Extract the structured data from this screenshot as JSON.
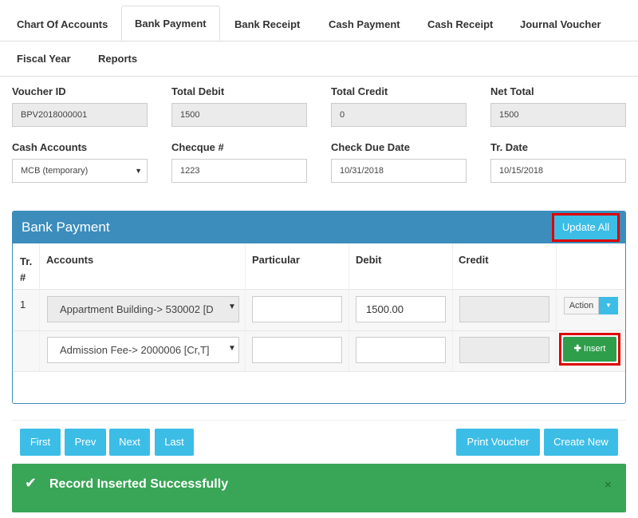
{
  "tabs": [
    {
      "label": "Chart Of Accounts"
    },
    {
      "label": "Bank Payment"
    },
    {
      "label": "Bank Receipt"
    },
    {
      "label": "Cash Payment"
    },
    {
      "label": "Cash Receipt"
    },
    {
      "label": "Journal Voucher"
    },
    {
      "label": "Fiscal Year"
    },
    {
      "label": "Reports"
    }
  ],
  "form": {
    "voucher_id": {
      "label": "Voucher ID",
      "value": "BPV2018000001"
    },
    "total_debit": {
      "label": "Total Debit",
      "value": "1500"
    },
    "total_credit": {
      "label": "Total Credit",
      "value": "0"
    },
    "net_total": {
      "label": "Net Total",
      "value": "1500"
    },
    "cash_accounts": {
      "label": "Cash Accounts",
      "value": "MCB (temporary)"
    },
    "cheque": {
      "label": "Checque #",
      "value": "1223"
    },
    "check_due_date": {
      "label": "Check Due Date",
      "value": "10/31/2018"
    },
    "tr_date": {
      "label": "Tr. Date",
      "value": "10/15/2018"
    }
  },
  "panel": {
    "title": "Bank Payment",
    "update_all": "Update All",
    "columns": [
      "Tr.\n#",
      "Accounts",
      "Particular",
      "Debit",
      "Credit"
    ],
    "rows": [
      {
        "tr": "1",
        "account": "Appartment Building-> 530002 [D",
        "particular": "",
        "debit": "1500.00",
        "credit": "",
        "action": "Action"
      },
      {
        "tr": "",
        "account": "Admission Fee-> 2000006 [Cr,T]",
        "particular": "",
        "debit": "",
        "credit": "",
        "insert": "Insert"
      }
    ]
  },
  "nav": {
    "first": "First",
    "prev": "Prev",
    "next": "Next",
    "last": "Last",
    "print_voucher": "Print Voucher",
    "create_new": "Create New"
  },
  "alert": {
    "message": "Record Inserted Successfully",
    "close": "×"
  },
  "colors": {
    "panel_blue": "#3c8dbc",
    "button_cyan": "#3cbde6",
    "success_green": "#39a556",
    "highlight_red": "#dd0000"
  }
}
